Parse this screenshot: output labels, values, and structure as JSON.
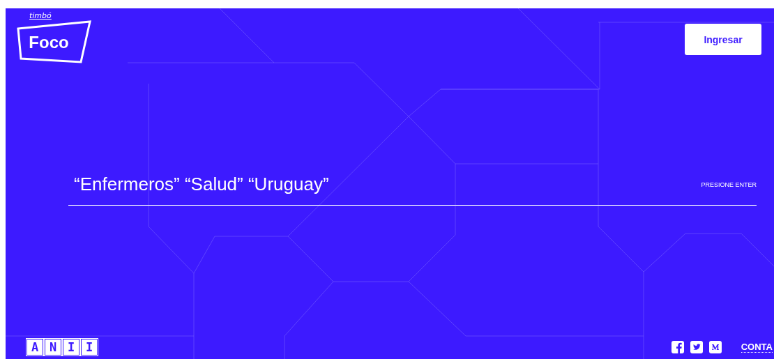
{
  "logo": {
    "brand": "timbó",
    "name": "Foco"
  },
  "header": {
    "login_button": "Ingresar"
  },
  "search": {
    "value": "“Enfermeros” “Salud” “Uruguay”",
    "hint": "PRESIONE ENTER"
  },
  "footer": {
    "partner_logo": [
      "A",
      "N",
      "I",
      "I"
    ],
    "social_icons": [
      {
        "kind": "facebook"
      },
      {
        "kind": "twitter"
      },
      {
        "kind": "medium"
      }
    ],
    "contact_link": "CONTA"
  }
}
